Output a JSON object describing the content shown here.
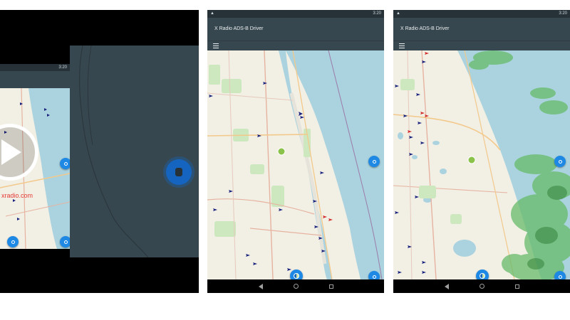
{
  "screenshot": {
    "panels": [
      {
        "id": "video-preview",
        "watermark": "xradio.com",
        "play_icon": "play-icon"
      },
      {
        "id": "map-phone-1",
        "app_title": "X Radio ADS-B Driver",
        "status_time": "3:20",
        "menu_icon": "hamburger-menu-icon",
        "map_layer": "street",
        "fab_icons": [
          "layers-icon",
          "my-location-icon",
          "settings-icon"
        ]
      },
      {
        "id": "map-phone-2",
        "app_title": "X Radio ADS-B Driver",
        "status_time": "3:20",
        "menu_icon": "hamburger-menu-icon",
        "map_layer": "weather-radar",
        "fab_icons": [
          "layers-icon",
          "my-location-icon",
          "settings-icon"
        ]
      }
    ],
    "colors": {
      "app_bar": "#37474f",
      "status_bar": "#263238",
      "water": "#aad3df",
      "land": "#f2efe4",
      "aircraft_blue": "#1a237e",
      "aircraft_red": "#d32f2f",
      "fab_blue": "#1e88e5",
      "radar_green": "#4caf50"
    },
    "nav_icons": [
      "back-icon",
      "home-icon",
      "recents-icon"
    ]
  }
}
